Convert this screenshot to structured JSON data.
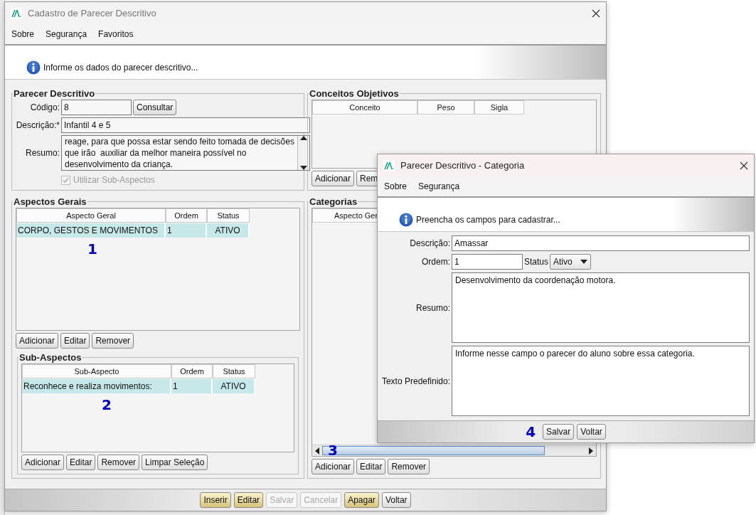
{
  "main_window": {
    "title": "Cadastro de Parecer Descritivo",
    "menu": [
      "Sobre",
      "Segurança",
      "Favoritos"
    ],
    "banner": "Informe os dados do parecer descritivo...",
    "parecer": {
      "legend": "Parecer Descritivo",
      "codigo_label": "Código:",
      "codigo": "8",
      "consultar": "Consultar",
      "descricao_label": "Descrição:*",
      "descricao": "Infantil 4 e 5",
      "resumo_label": "Resumo:",
      "resumo_lines": [
        "reage, para que possa estar sendo feito tomada de decisões",
        "que irão  auxiliar da melhor maneira possível no",
        "desenvolvimento da criança."
      ],
      "sub_aspectos_option": {
        "label": "Utilizar Sub-Aspectos",
        "checked": true,
        "disabled": true
      }
    },
    "aspectos": {
      "legend": "Aspectos Gerais",
      "columns": [
        {
          "label": "Aspecto Geral",
          "kind": "text"
        },
        {
          "label": "Ordem",
          "kind": "text"
        },
        {
          "label": "Status",
          "kind": "status"
        }
      ],
      "rows": [
        {
          "cells": [
            "CORPO, GESTOS E MOVIMENTOS",
            "1",
            "ATIVO"
          ],
          "selected": true
        }
      ],
      "annotation": "1",
      "buttons": [
        "Adicionar",
        "Editar",
        "Remover"
      ],
      "sub_aspectos": {
        "legend": "Sub-Aspectos",
        "columns": [
          {
            "label": "Sub-Aspecto",
            "kind": "text"
          },
          {
            "label": "Ordem",
            "kind": "text"
          },
          {
            "label": "Status",
            "kind": "status"
          }
        ],
        "rows": [
          {
            "cells": [
              "Reconhece e realiza movimentos:",
              "1",
              "ATIVO"
            ],
            "selected": true
          }
        ],
        "annotation": "2",
        "buttons": [
          "Adicionar",
          "Editar",
          "Remover",
          "Limpar Seleção"
        ]
      }
    },
    "conceitos": {
      "legend": "Conceitos Objetivos",
      "columns": [
        {
          "label": "Conceito"
        },
        {
          "label": "Peso"
        },
        {
          "label": "Sigla"
        }
      ],
      "buttons": [
        "Adicionar",
        "Rem"
      ]
    },
    "categorias": {
      "legend": "Categorias",
      "columns": [
        {
          "label": "Aspecto Ger"
        }
      ],
      "annotation": "3",
      "buttons": [
        "Adicionar",
        "Editar",
        "Remover"
      ]
    },
    "actions": [
      {
        "label": "Inserir",
        "highlighted": true,
        "disabled": false
      },
      {
        "label": "Editar",
        "highlighted": true,
        "disabled": false
      },
      {
        "label": "Salvar",
        "highlighted": false,
        "disabled": true
      },
      {
        "label": "Cancelar",
        "highlighted": false,
        "disabled": true
      },
      {
        "label": "Apagar",
        "highlighted": true,
        "disabled": false
      },
      {
        "label": "Voltar",
        "highlighted": false,
        "disabled": false
      }
    ]
  },
  "dialog": {
    "title": "Parecer Descritivo - Categoria",
    "menu": [
      "Sobre",
      "Segurança"
    ],
    "banner": "Preencha os campos para cadastrar...",
    "descricao_label": "Descrição:",
    "descricao": "Amassar",
    "ordem_label": "Ordem:",
    "ordem": "1",
    "status_label": "Status",
    "status": "Ativo",
    "resumo_label": "Resumo:",
    "resumo": "Desenvolvimento da coordenação motora.",
    "texto_label": "Texto Predefinido:",
    "texto": "Informe nesse campo o parecer do aluno sobre essa categoria.",
    "annotation": "4",
    "buttons": [
      "Salvar",
      "Voltar"
    ]
  }
}
